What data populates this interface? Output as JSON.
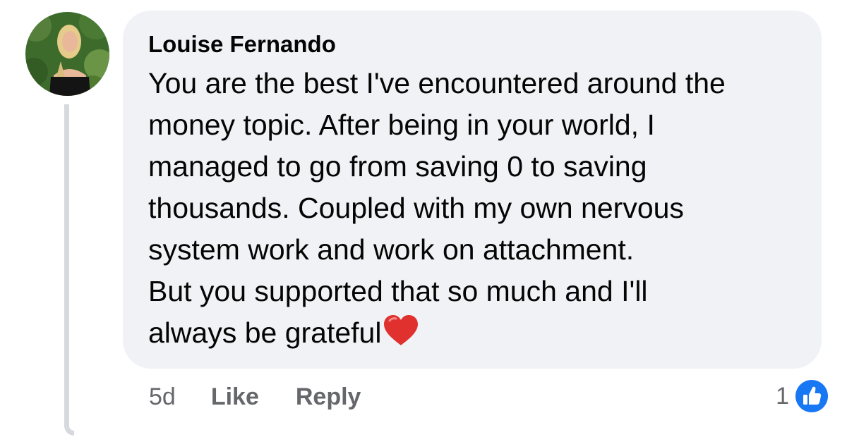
{
  "comment": {
    "author": "Louise Fernando",
    "lines": [
      "You are the best I've encountered around the",
      "money topic. After being in your world, I",
      "managed to go from saving 0 to saving",
      "thousands. Coupled with my own nervous",
      "system work and work on attachment.",
      "But you supported that so much and I'll",
      "always be grateful"
    ],
    "emoji": "heart-emoji",
    "colors": {
      "bubble": "#f0f2f5",
      "text": "#050505",
      "meta": "#65676b",
      "like_blue": "#1877f2",
      "heart_red": "#e0312f"
    }
  },
  "actions": {
    "time": "5d",
    "like_label": "Like",
    "reply_label": "Reply"
  },
  "reactions": {
    "count": "1",
    "icon": "like-thumbs-up-icon"
  }
}
